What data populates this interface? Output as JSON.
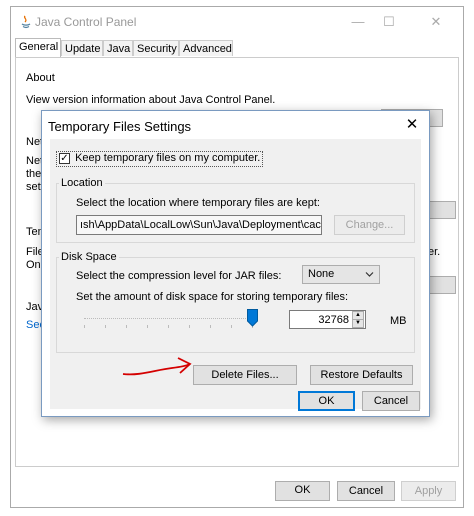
{
  "window": {
    "title": "Java Control Panel",
    "minimize": "—",
    "maximize": "☐",
    "close": "✕"
  },
  "tabs": [
    "General",
    "Update",
    "Java",
    "Security",
    "Advanced"
  ],
  "general": {
    "about_heading": "About",
    "about_text": "View version information about Java Control Panel.",
    "net_heading_partial": "Net",
    "net_text_lines": [
      "Net",
      "the",
      "sett"
    ],
    "temp_heading_partial": "Tem",
    "temp_text_lines": [
      "File",
      "Onl"
    ],
    "temp_text_right": "er.",
    "java_heading_partial": "Java",
    "see_link_partial": "See"
  },
  "main_buttons": {
    "ok": "OK",
    "cancel": "Cancel",
    "apply": "Apply"
  },
  "dialog": {
    "title": "Temporary Files Settings",
    "close": "✕",
    "keep_checkbox_label": "Keep temporary files on my computer.",
    "keep_checked": true,
    "location": {
      "group_label": "Location",
      "prompt": "Select the location where temporary files are kept:",
      "path_value": "ısh\\AppData\\LocalLow\\Sun\\Java\\Deployment\\cache",
      "change_button": "Change..."
    },
    "disk_space": {
      "group_label": "Disk Space",
      "compression_prompt": "Select the compression level for JAR files:",
      "compression_value": "None",
      "amount_prompt": "Set the amount of disk space for storing temporary files:",
      "amount_value": "32768",
      "unit": "MB",
      "slider_fraction": 0.98
    },
    "delete_button": "Delete Files...",
    "restore_button": "Restore Defaults",
    "ok_button": "OK",
    "cancel_button": "Cancel"
  },
  "annotation": {
    "arrow_color": "#d40000"
  }
}
